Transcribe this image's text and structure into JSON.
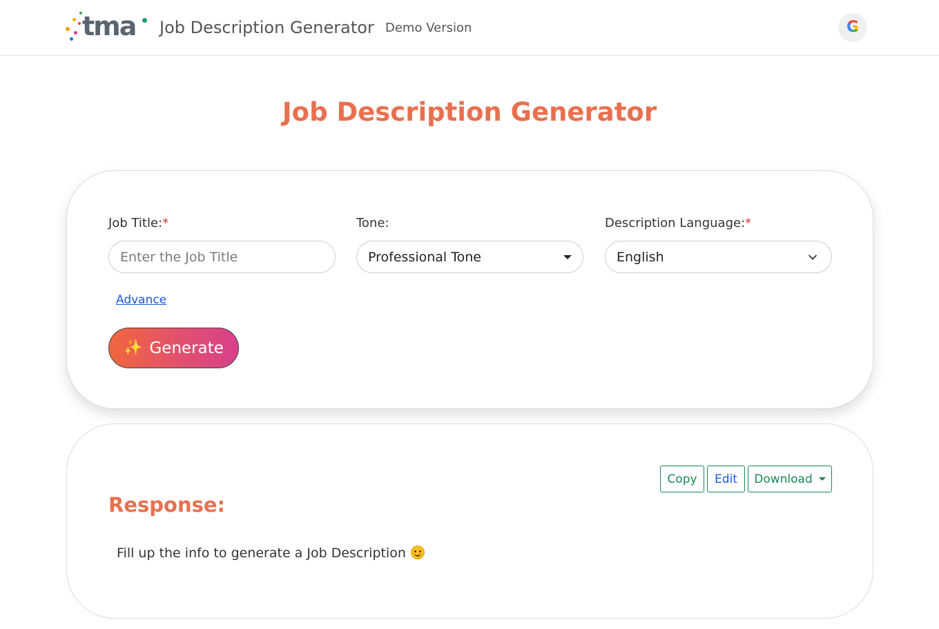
{
  "header": {
    "logo_text": "tma",
    "app_title": "Job Description Generator",
    "version_label": "Demo Version",
    "account_icon": "google-icon"
  },
  "page": {
    "title": "Job Description Generator"
  },
  "form": {
    "job_title": {
      "label": "Job Title:",
      "required_mark": "*",
      "placeholder": "Enter the Job Title",
      "value": ""
    },
    "tone": {
      "label": "Tone:",
      "selected": "Professional Tone"
    },
    "language": {
      "label": "Description Language:",
      "required_mark": "*",
      "selected": "English"
    },
    "advance_link": "Advance",
    "generate_button": {
      "icon": "sparkles-icon",
      "label": "Generate"
    }
  },
  "response": {
    "copy_label": "Copy",
    "edit_label": "Edit",
    "download_label": "Download",
    "title": "Response:",
    "message": "Fill up the info to generate a Job Description",
    "message_icon": "smiling-face-icon"
  },
  "colors": {
    "accent": "#e8704f",
    "link": "#1a56db",
    "success_outline": "#198754",
    "generate_gradient_start": "#f0673d",
    "generate_gradient_end": "#d8408a"
  }
}
